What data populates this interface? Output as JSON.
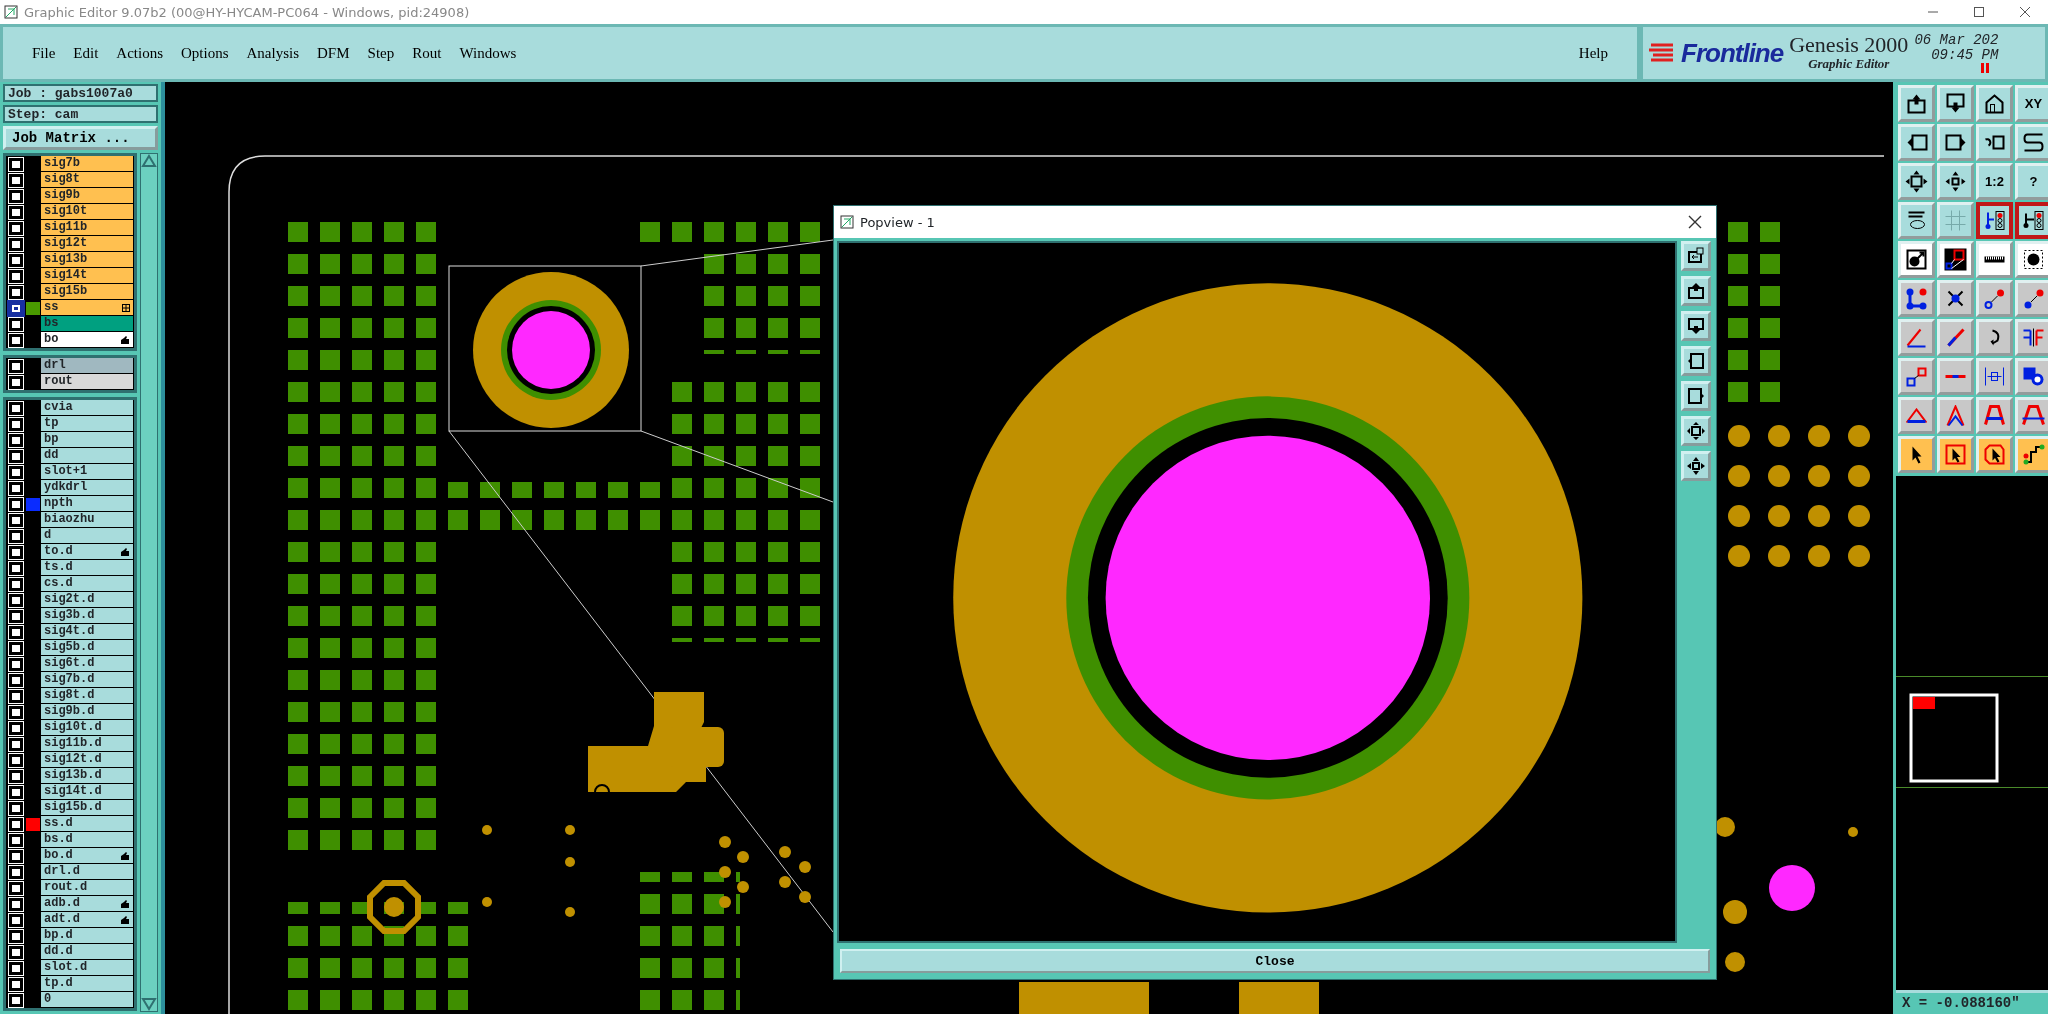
{
  "window": {
    "title": "Graphic Editor 9.07b2 (00@HY-HYCAM-PC064 - Windows, pid:24908)"
  },
  "menu": [
    "File",
    "Edit",
    "Actions",
    "Options",
    "Analysis",
    "DFM",
    "Step",
    "Rout",
    "Windows"
  ],
  "help": "Help",
  "brand": {
    "logo": "Frontline",
    "product": "Genesis 2000",
    "subtitle": "Graphic Editor",
    "date": "06 Mar 202",
    "time": "09:45 PM"
  },
  "job": {
    "job": "Job : gabs1007a0",
    "step": "Step: cam",
    "matrix_button": "Job Matrix ..."
  },
  "layer_groups": [
    [
      {
        "name": "sig7b",
        "kind": "signal",
        "focused": false
      },
      {
        "name": "sig8t",
        "kind": "signal",
        "focused": false
      },
      {
        "name": "sig9b",
        "kind": "signal",
        "focused": false
      },
      {
        "name": "sig10t",
        "kind": "signal",
        "focused": false
      },
      {
        "name": "sig11b",
        "kind": "signal",
        "focused": false
      },
      {
        "name": "sig12t",
        "kind": "signal",
        "focused": false
      },
      {
        "name": "sig13b",
        "kind": "signal",
        "focused": false
      },
      {
        "name": "sig14t",
        "kind": "signal",
        "focused": false
      },
      {
        "name": "sig15b",
        "kind": "signal",
        "focused": false
      },
      {
        "name": "ss",
        "kind": "signal",
        "focused": true,
        "color": "#4a9a00"
      },
      {
        "name": "bs",
        "kind": "mask",
        "focused": false
      },
      {
        "name": "bo",
        "kind": "silk",
        "focused": false
      }
    ],
    [
      {
        "name": "drl",
        "kind": "drill",
        "focused": false
      },
      {
        "name": "rout",
        "kind": "rout",
        "focused": false
      }
    ],
    [
      {
        "name": "cvia",
        "kind": "doc",
        "focused": false
      },
      {
        "name": "tp",
        "kind": "doc",
        "focused": false
      },
      {
        "name": "bp",
        "kind": "doc",
        "focused": false
      },
      {
        "name": "dd",
        "kind": "doc",
        "focused": false
      },
      {
        "name": "slot+1",
        "kind": "doc",
        "focused": false
      },
      {
        "name": "ydkdrl",
        "kind": "doc",
        "focused": false
      },
      {
        "name": "npth",
        "kind": "doc",
        "focused": false,
        "color": "#0a2cff"
      },
      {
        "name": "biaozhu",
        "kind": "doc",
        "focused": false
      },
      {
        "name": "d",
        "kind": "doc",
        "focused": false
      },
      {
        "name": "to.d",
        "kind": "doc",
        "focused": false
      },
      {
        "name": "ts.d",
        "kind": "doc",
        "focused": false
      },
      {
        "name": "cs.d",
        "kind": "doc",
        "focused": false
      },
      {
        "name": "sig2t.d",
        "kind": "doc",
        "focused": false
      },
      {
        "name": "sig3b.d",
        "kind": "doc",
        "focused": false
      },
      {
        "name": "sig4t.d",
        "kind": "doc",
        "focused": false
      },
      {
        "name": "sig5b.d",
        "kind": "doc",
        "focused": false
      },
      {
        "name": "sig6t.d",
        "kind": "doc",
        "focused": false
      },
      {
        "name": "sig7b.d",
        "kind": "doc",
        "focused": false
      },
      {
        "name": "sig8t.d",
        "kind": "doc",
        "focused": false
      },
      {
        "name": "sig9b.d",
        "kind": "doc",
        "focused": false
      },
      {
        "name": "sig10t.d",
        "kind": "doc",
        "focused": false
      },
      {
        "name": "sig11b.d",
        "kind": "doc",
        "focused": false
      },
      {
        "name": "sig12t.d",
        "kind": "doc",
        "focused": false
      },
      {
        "name": "sig13b.d",
        "kind": "doc",
        "focused": false
      },
      {
        "name": "sig14t.d",
        "kind": "doc",
        "focused": false
      },
      {
        "name": "sig15b.d",
        "kind": "doc",
        "focused": false
      },
      {
        "name": "ss.d",
        "kind": "doc",
        "focused": false,
        "color": "#ff0000"
      },
      {
        "name": "bs.d",
        "kind": "doc",
        "focused": false
      },
      {
        "name": "bo.d",
        "kind": "doc",
        "focused": false
      },
      {
        "name": "drl.d",
        "kind": "doc",
        "focused": false
      },
      {
        "name": "rout.d",
        "kind": "doc",
        "focused": false
      },
      {
        "name": "adb.d",
        "kind": "doc",
        "focused": false
      },
      {
        "name": "adt.d",
        "kind": "doc",
        "focused": false
      },
      {
        "name": "bp.d",
        "kind": "doc",
        "focused": false
      },
      {
        "name": "dd.d",
        "kind": "doc",
        "focused": false
      },
      {
        "name": "slot.d",
        "kind": "doc",
        "focused": false
      },
      {
        "name": "tp.d",
        "kind": "doc",
        "focused": false
      },
      {
        "name": "0",
        "kind": "doc",
        "focused": false
      }
    ]
  ],
  "toolbar": [
    {
      "kind": "view",
      "selected": false
    },
    {
      "kind": "view",
      "selected": false
    },
    {
      "kind": "view",
      "selected": false
    },
    {
      "kind": "view",
      "selected": false,
      "label": "XY"
    },
    {
      "kind": "view",
      "selected": false
    },
    {
      "kind": "view",
      "selected": false
    },
    {
      "kind": "view",
      "selected": false
    },
    {
      "kind": "view",
      "selected": false
    },
    {
      "kind": "view",
      "selected": false
    },
    {
      "kind": "view",
      "selected": false
    },
    {
      "kind": "view",
      "selected": false,
      "label": "1:2"
    },
    {
      "kind": "view",
      "selected": false,
      "label": "?"
    },
    {
      "kind": "view",
      "selected": false
    },
    {
      "kind": "view",
      "selected": false
    },
    {
      "kind": "view",
      "selected": true
    },
    {
      "kind": "view",
      "selected": true
    },
    {
      "kind": "measure",
      "selected": false
    },
    {
      "kind": "measure",
      "selected": false
    },
    {
      "kind": "measure",
      "selected": false
    },
    {
      "kind": "measure",
      "selected": false
    },
    {
      "kind": "edit",
      "selected": false
    },
    {
      "kind": "edit",
      "selected": false
    },
    {
      "kind": "edit",
      "selected": false
    },
    {
      "kind": "edit",
      "selected": false
    },
    {
      "kind": "edit",
      "selected": false
    },
    {
      "kind": "edit",
      "selected": false
    },
    {
      "kind": "edit",
      "selected": false
    },
    {
      "kind": "edit",
      "selected": false
    },
    {
      "kind": "edit",
      "selected": false
    },
    {
      "kind": "edit",
      "selected": false
    },
    {
      "kind": "edit",
      "selected": false
    },
    {
      "kind": "edit",
      "selected": false
    },
    {
      "kind": "edit",
      "selected": false
    },
    {
      "kind": "edit",
      "selected": false
    },
    {
      "kind": "edit",
      "selected": false
    },
    {
      "kind": "edit",
      "selected": false
    },
    {
      "kind": "select",
      "selected": false
    },
    {
      "kind": "select",
      "selected": false
    },
    {
      "kind": "select",
      "selected": false
    },
    {
      "kind": "select",
      "selected": false
    }
  ],
  "popview": {
    "title": "Popview - 1",
    "close": "Close"
  },
  "status": "X = -0.088160\""
}
